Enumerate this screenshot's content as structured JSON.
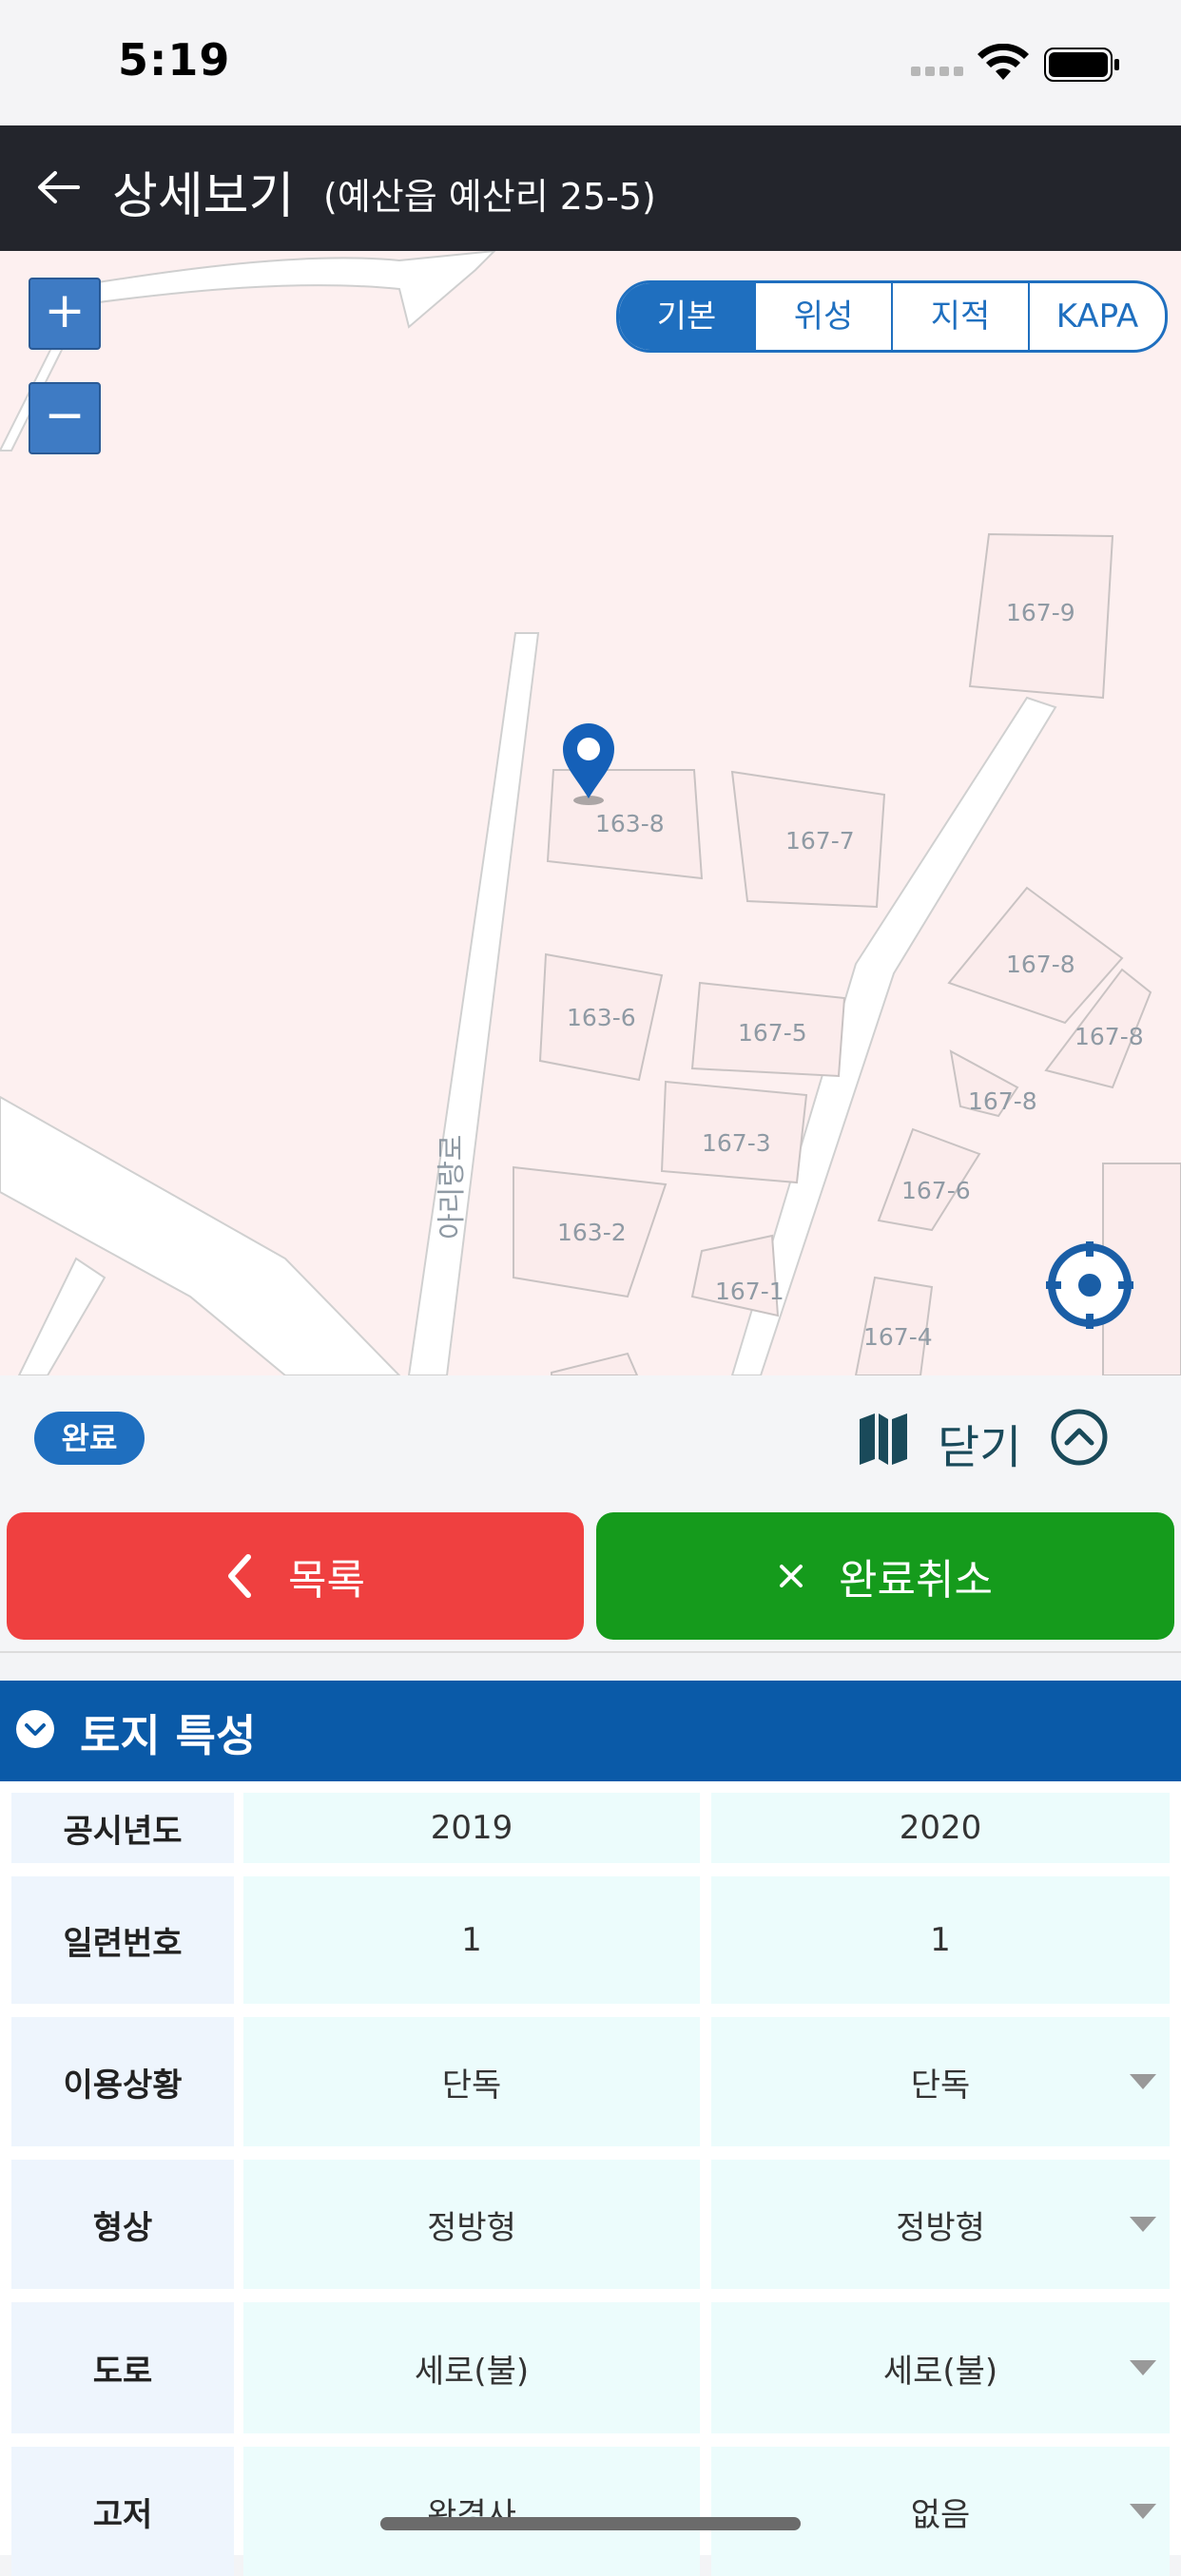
{
  "status_bar": {
    "time": "5:19"
  },
  "header": {
    "title": "상세보기",
    "subtitle": "(예산읍 예산리 25-5)"
  },
  "map": {
    "zoom_in": "+",
    "zoom_out": "−",
    "types": [
      "기본",
      "위성",
      "지적",
      "KAPA"
    ],
    "selected_type": "기본",
    "road_label": "아리랑로",
    "parcels": [
      "167-9",
      "163-8",
      "167-7",
      "167-8",
      "167-8",
      "163-6",
      "167-5",
      "167-8",
      "167-3",
      "167-6",
      "163-2",
      "167-1",
      "167-4"
    ]
  },
  "bar": {
    "badge": "완료",
    "close_label": "닫기"
  },
  "actions": {
    "list_label": "목록",
    "cancel_label": "완료취소"
  },
  "section": {
    "title": "토지 특성"
  },
  "table": {
    "rows": [
      {
        "label": "공시년도",
        "v2019": "2019",
        "v2020": "2020",
        "dropdown": false
      },
      {
        "label": "일련번호",
        "v2019": "1",
        "v2020": "1",
        "dropdown": false
      },
      {
        "label": "이용상황",
        "v2019": "단독",
        "v2020": "단독",
        "dropdown": true
      },
      {
        "label": "형상",
        "v2019": "정방형",
        "v2020": "정방형",
        "dropdown": true
      },
      {
        "label": "도로",
        "v2019": "세로(불)",
        "v2020": "세로(불)",
        "dropdown": true
      },
      {
        "label": "고저",
        "v2019": "완경사",
        "v2020": "없음",
        "dropdown": true
      }
    ]
  },
  "colors": {
    "header_bg": "#23252c",
    "accent_blue": "#1f6fbf",
    "section_blue": "#0a5aa8",
    "red_button": "#ef4040",
    "green_button": "#159b1c"
  }
}
